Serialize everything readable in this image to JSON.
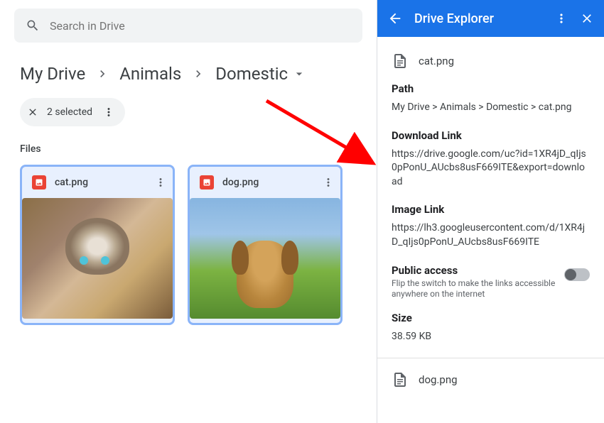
{
  "search": {
    "placeholder": "Search in Drive"
  },
  "breadcrumb": {
    "items": [
      "My Drive",
      "Animals",
      "Domestic"
    ]
  },
  "selection": {
    "text": "2 selected"
  },
  "filesHeading": "Files",
  "files": [
    {
      "name": "cat.png"
    },
    {
      "name": "dog.png"
    }
  ],
  "side": {
    "title": "Drive Explorer",
    "file1": {
      "name": "cat.png",
      "pathLabel": "Path",
      "path": "My Drive > Animals > Domestic > cat.png",
      "dlLabel": "Download Link",
      "dl": "https://drive.google.com/uc?id=1XR4jD_qIjs0pPonU_AUcbs8usF669ITE&export=download",
      "imgLabel": "Image Link",
      "img": "https://lh3.googleusercontent.com/d/1XR4jD_qIjs0pPonU_AUcbs8usF669ITE",
      "accessLabel": "Public access",
      "accessSub": "Flip the switch to make the links accessible anywhere on the internet",
      "sizeLabel": "Size",
      "size": "38.59 KB"
    },
    "file2": {
      "name": "dog.png"
    }
  }
}
